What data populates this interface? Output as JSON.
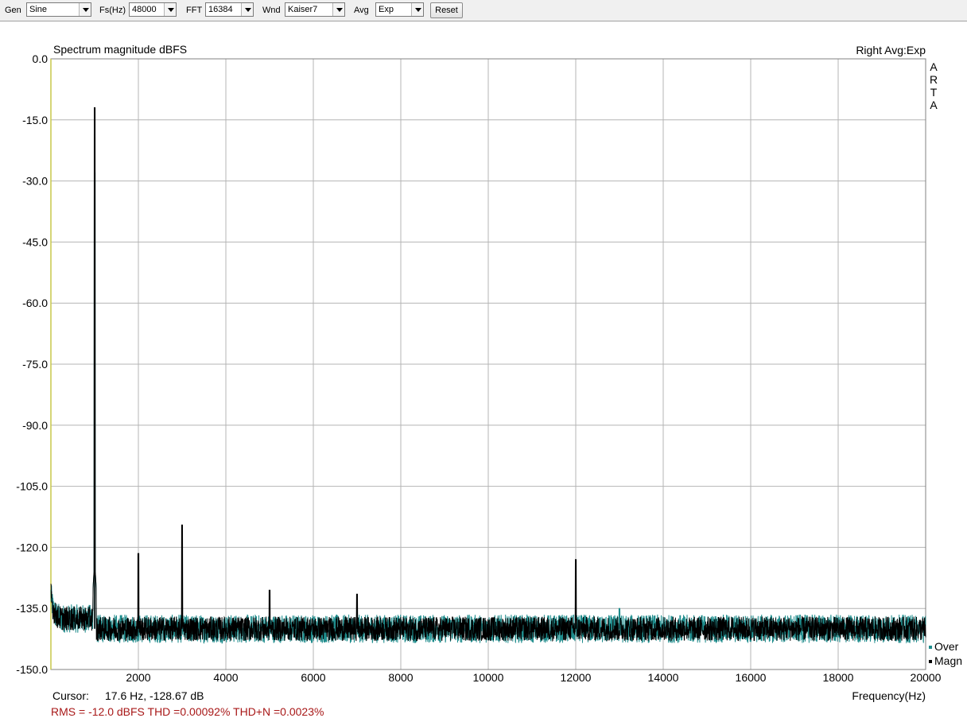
{
  "toolbar": {
    "gen_label": "Gen",
    "gen_value": "Sine",
    "fs_label": "Fs(Hz)",
    "fs_value": "48000",
    "fft_label": "FFT",
    "fft_value": "16384",
    "wnd_label": "Wnd",
    "wnd_value": "Kaiser7",
    "avg_label": "Avg",
    "avg_value": "Exp",
    "reset_label": "Reset"
  },
  "chart_data": {
    "type": "line",
    "title": "Spectrum magnitude dBFS",
    "channel_info": "Right Avg:Exp",
    "side_logo": [
      "A",
      "R",
      "T",
      "A"
    ],
    "xlabel": "Frequency(Hz)",
    "ylabel": "",
    "xlim": [
      0,
      20000
    ],
    "ylim": [
      -150,
      0
    ],
    "x_ticks": [
      "2000",
      "4000",
      "6000",
      "8000",
      "10000",
      "12000",
      "14000",
      "16000",
      "18000",
      "20000"
    ],
    "y_ticks": [
      "0.0",
      "-15.0",
      "-30.0",
      "-45.0",
      "-60.0",
      "-75.0",
      "-90.0",
      "-105.0",
      "-120.0",
      "-135.0",
      "-150.0"
    ],
    "grid": true,
    "legend": [
      {
        "name": "Over",
        "color": "#1e8c8c"
      },
      {
        "name": "Magn",
        "color": "#000000"
      }
    ],
    "legend_position": "bottom-right",
    "noise_floor_db": -140,
    "series": [
      {
        "name": "Magn",
        "color": "#000000",
        "peaks": [
          {
            "x": 1000,
            "y": -12.0
          },
          {
            "x": 2000,
            "y": -121.5
          },
          {
            "x": 3000,
            "y": -114.5
          },
          {
            "x": 5000,
            "y": -130.5
          },
          {
            "x": 7000,
            "y": -131.5
          },
          {
            "x": 12000,
            "y": -123.0
          }
        ]
      },
      {
        "name": "Over",
        "color": "#1e8c8c",
        "peaks": [
          {
            "x": 1000,
            "y": -28.0
          },
          {
            "x": 13000,
            "y": -135.0
          }
        ]
      }
    ],
    "colors": {
      "grid": "#b4b4b4",
      "frame": "#808080",
      "left_axis": "#c8c84a",
      "stats": "#a81818"
    }
  },
  "status": {
    "cursor_label": "Cursor:",
    "cursor_value": "17.6 Hz, -128.67 dB",
    "stats": "RMS =  -12.0 dBFS   THD =0.00092%   THD+N =0.0023%"
  }
}
